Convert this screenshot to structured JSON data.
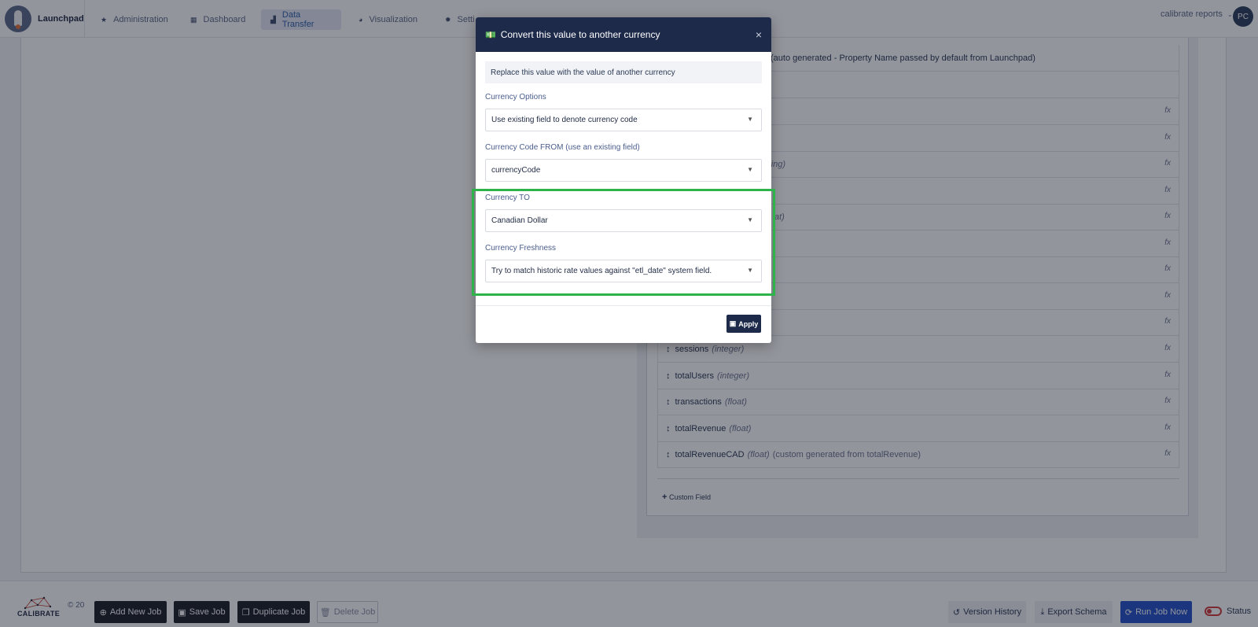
{
  "nav": {
    "brand": "Launchpad",
    "items": [
      {
        "label": "Administration",
        "icon": "star-icon"
      },
      {
        "label": "Dashboard",
        "icon": "grid-icon"
      },
      {
        "label": "Data Transfer",
        "icon": "transfer-icon"
      },
      {
        "label": "Visualization",
        "icon": "chart-icon"
      },
      {
        "label": "Setti",
        "icon": "gear-icon"
      }
    ],
    "active_item": "Data Transfer",
    "account": "calibrate reports",
    "avatar_initials": "PC"
  },
  "fields": {
    "top_note": "(auto generated - Property Name passed by default from Launchpad)",
    "partial_rows": [
      {
        "text": "ring)"
      },
      {
        "text": "at)"
      }
    ],
    "rows": [
      {
        "name": "sessions",
        "type": "(integer)",
        "note": ""
      },
      {
        "name": "totalUsers",
        "type": "(integer)",
        "note": ""
      },
      {
        "name": "transactions",
        "type": "(float)",
        "note": ""
      },
      {
        "name": "totalRevenue",
        "type": "(float)",
        "note": ""
      },
      {
        "name": "totalRevenueCAD",
        "type": "(float)",
        "note": "(custom generated from totalRevenue)"
      }
    ],
    "fx_symbol": "fx",
    "add_custom_field": "Custom Field"
  },
  "modal": {
    "title": "Convert this value to another currency",
    "info": "Replace this value with the value of another currency",
    "currency_options_label": "Currency Options",
    "currency_options_value": "Use existing field to denote currency code",
    "currency_code_from_label": "Currency Code FROM (use an existing field)",
    "currency_code_from_value": "currencyCode",
    "currency_to_label": "Currency TO",
    "currency_to_value": "Canadian Dollar",
    "freshness_label": "Currency Freshness",
    "freshness_value": "Try to match historic rate values against \"etl_date\" system field.",
    "apply_label": "Apply",
    "highlight_color": "#2db34a"
  },
  "footer": {
    "logo_text": "CALIBRATE",
    "copyright": "© 20",
    "add_job": "Add New Job",
    "save_job": "Save Job",
    "duplicate_job": "Duplicate Job",
    "delete_job": "Delete Job",
    "version_history": "Version History",
    "export_schema": "Export Schema",
    "run_job": "Run Job Now",
    "status": "Status"
  },
  "colors": {
    "nav_dark": "#1d2a4a",
    "primary": "#2552c8",
    "status_off": "#d23b3b"
  }
}
